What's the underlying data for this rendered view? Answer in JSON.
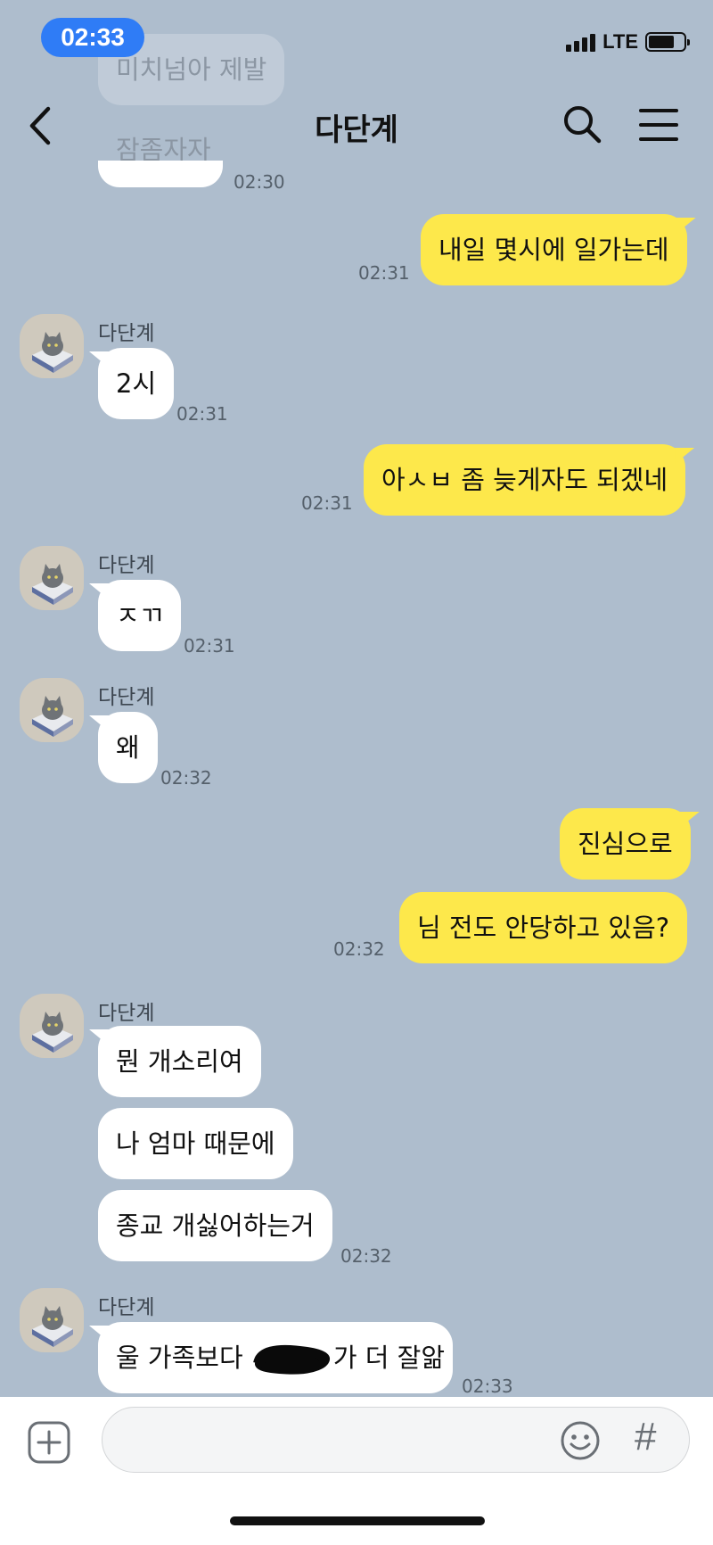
{
  "status_bar": {
    "time": "02:33",
    "network": "LTE",
    "battery_level": 0.74
  },
  "header": {
    "title": "다단계",
    "back_icon": "chevron-left-icon",
    "search_icon": "search-icon",
    "menu_icon": "hamburger-menu-icon"
  },
  "messages": {
    "m0": {
      "text": "미치넘아 제발"
    },
    "m1": {
      "text": "잠좀자자",
      "time": "02:30"
    },
    "m2": {
      "text": "내일 몇시에 일가는데",
      "time": "02:31"
    },
    "m3": {
      "sender": "다단계",
      "text": "2시",
      "time": "02:31"
    },
    "m4": {
      "text": "아ㅅㅂ 좀 늦게자도 되겠네",
      "time": "02:31"
    },
    "m5": {
      "sender": "다단계",
      "text": "ㅈㄲ",
      "time": "02:31"
    },
    "m6": {
      "sender": "다단계",
      "text": "왜",
      "time": "02:32"
    },
    "m7": {
      "text": "진심으로"
    },
    "m8": {
      "text": "님 전도 안당하고 있음?",
      "time": "02:32"
    },
    "m9": {
      "sender": "다단계",
      "text": "뭔 개소리여"
    },
    "m10": {
      "text": "나 엄마 때문에"
    },
    "m11": {
      "text": "종교 개싫어하는거",
      "time": "02:32"
    },
    "m12": {
      "sender": "다단계",
      "text_before": "울 가족보다 ",
      "text_after": "가 더 잘앎",
      "time": "02:33"
    }
  },
  "input_bar": {
    "placeholder": "",
    "plus_icon": "plus-square-icon",
    "emoji_icon": "emoji-icon",
    "hash_icon": "#"
  },
  "colors": {
    "background": "#aebdcd",
    "my_bubble": "#fde84b",
    "their_bubble": "#ffffff",
    "time_pill": "#2f7cf6"
  }
}
